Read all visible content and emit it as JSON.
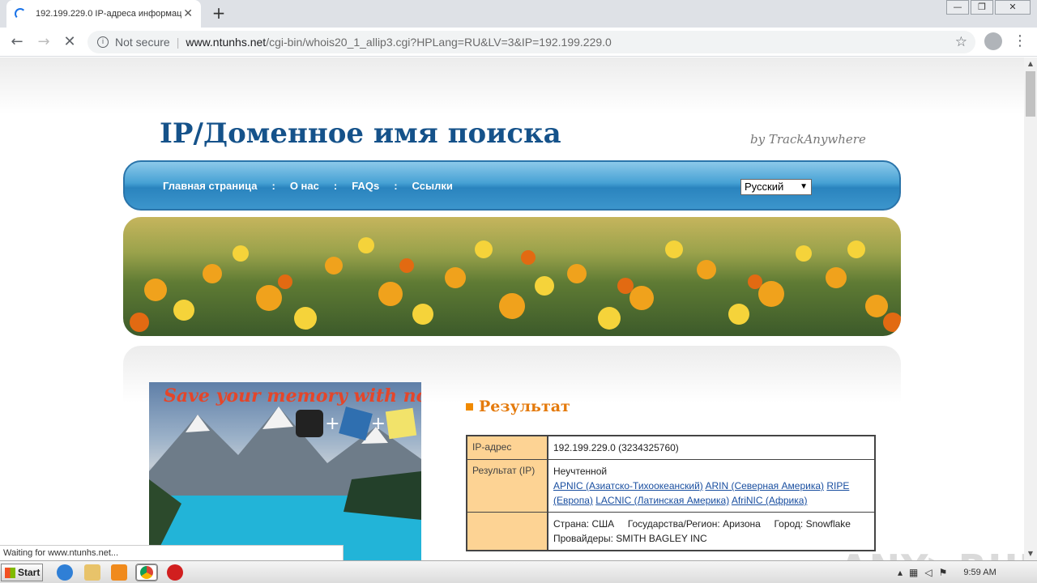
{
  "browser": {
    "tab_title": "192.199.229.0 IP-адреса информац",
    "tab_close": "✕",
    "new_tab": "+",
    "back": "←",
    "forward": "→",
    "reload": "✕",
    "security_label": "Not secure",
    "url_host": "www.ntunhs.net",
    "url_path": "/cgi-bin/whois20_1_allip3.cgi?HPLang=RU&LV=3&IP=192.199.229.0",
    "win_min": "—",
    "win_max": "❐",
    "win_close": "✕"
  },
  "page": {
    "title": "IP/Доменное имя поиска",
    "byline": "by TrackAnywhere",
    "nav": {
      "home": "Главная страница",
      "about": "О нас",
      "faqs": "FAQs",
      "links": "Ссылки",
      "separator": ":"
    },
    "language_select": "Русский",
    "ad_text": "Save your memory with notes",
    "result_heading": "Результат",
    "table": {
      "ip_key": "IP-адрес",
      "ip_value": "192.199.229.0 (3234325760)",
      "result_key": "Результат (IP)",
      "result_status": "Неучтенной",
      "registries": [
        "APNIC (Азиатско-Тихоокеанский)",
        "ARIN (Северная Америка)",
        "RIPE (Европа)",
        "LACNIC (Латинская Америка)",
        "AfriNIC (Африка)"
      ],
      "country_line": "Страна: США     Государства/Регион: Аризона     Город: Snowflake",
      "provider_line": "Провайдеры: SMITH BAGLEY INC"
    }
  },
  "status_bar": "Waiting for www.ntunhs.net...",
  "watermark": "ANY▷RUN",
  "taskbar": {
    "start": "Start",
    "clock": "9:59 AM"
  },
  "colors": {
    "title_blue": "#15528a",
    "nav_blue": "#3c95cc",
    "result_orange": "#e47a0c",
    "key_cell": "#fdd394"
  }
}
